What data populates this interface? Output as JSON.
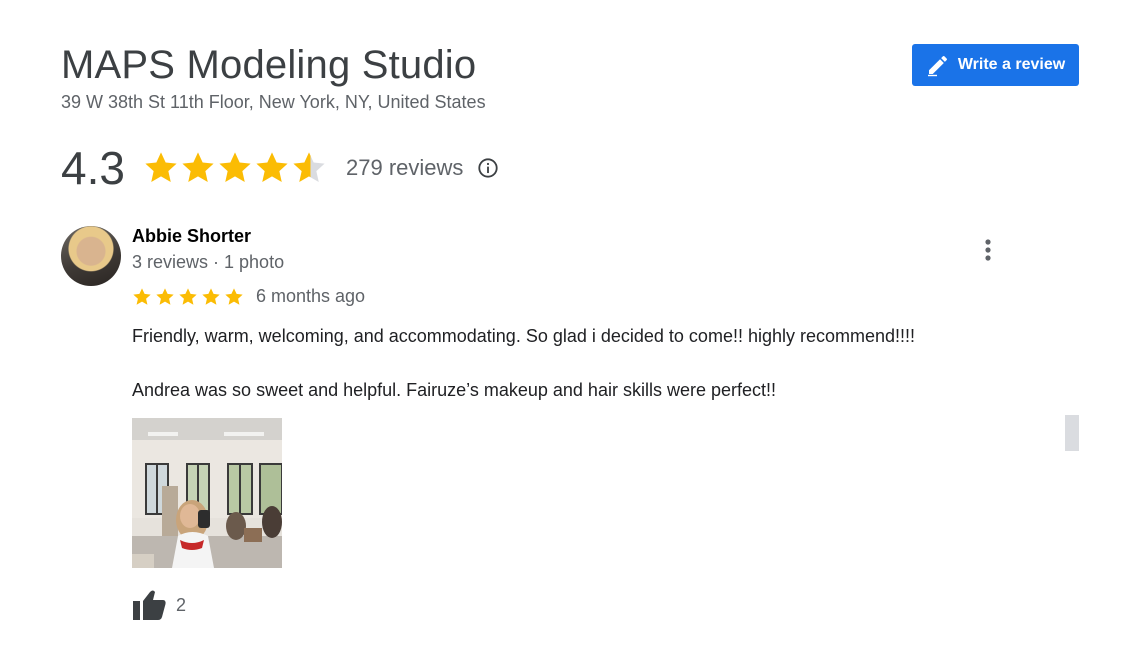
{
  "place": {
    "name": "MAPS Modeling Studio",
    "address": "39 W 38th St 11th Floor, New York, NY, United States"
  },
  "actions": {
    "write_review_label": "Write a review",
    "write_review_icon": "pencil-icon"
  },
  "summary": {
    "rating": "4.3",
    "rating_value": 4.3,
    "stars_max": 5,
    "review_count_label": "279 reviews",
    "info_icon": "info-icon"
  },
  "review": {
    "reviewer_name": "Abbie Shorter",
    "reviewer_meta": "3 reviews · 1 photo",
    "stars": 5,
    "date": "6 months ago",
    "paragraphs": [
      "Friendly, warm, welcoming, and accommodating. So glad i decided to come!! highly recommend!!!!",
      "Andrea was so sweet and helpful. Fairuze’s makeup and hair skills were perfect!!"
    ],
    "likes": "2",
    "more_icon": "more-vert-icon",
    "like_icon": "thumbs-up-icon"
  },
  "colors": {
    "accent": "#1a73e8",
    "star": "#fbbc04",
    "star_empty": "#dadce0",
    "text_primary": "#202124",
    "text_secondary": "#5f6368"
  }
}
